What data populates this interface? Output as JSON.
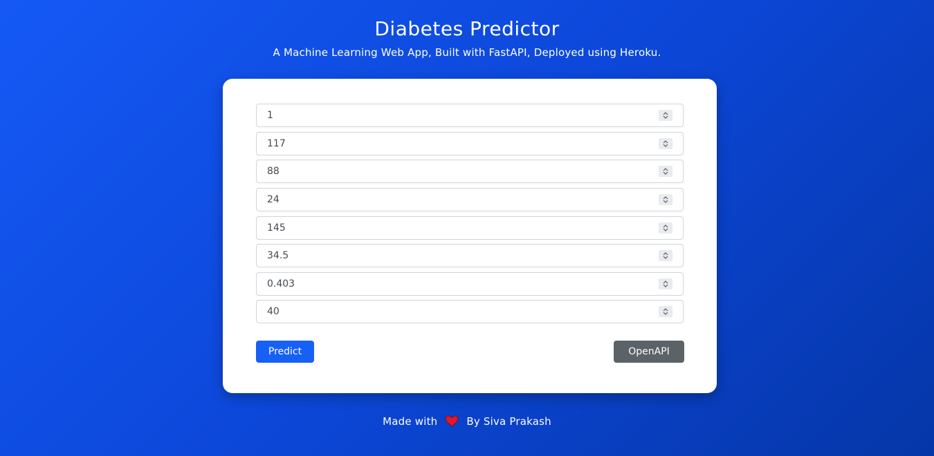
{
  "header": {
    "title": "Diabetes Predictor",
    "subtitle": "A Machine Learning Web App, Built with FastAPI, Deployed using Heroku."
  },
  "form": {
    "fields": [
      {
        "value": "1"
      },
      {
        "value": "117"
      },
      {
        "value": "88"
      },
      {
        "value": "24"
      },
      {
        "value": "145"
      },
      {
        "value": "34.5"
      },
      {
        "value": "0.403"
      },
      {
        "value": "40"
      }
    ],
    "predict_label": "Predict",
    "openapi_label": "OpenAPI"
  },
  "footer": {
    "made_with": "Made with",
    "by": "By Siva Prakash",
    "heart_icon": "heart-icon"
  },
  "colors": {
    "background_start": "#1559f5",
    "background_end": "#0536a8",
    "primary_button": "#1760f6",
    "secondary_button": "#5b6268",
    "heart": "#e0182d"
  }
}
